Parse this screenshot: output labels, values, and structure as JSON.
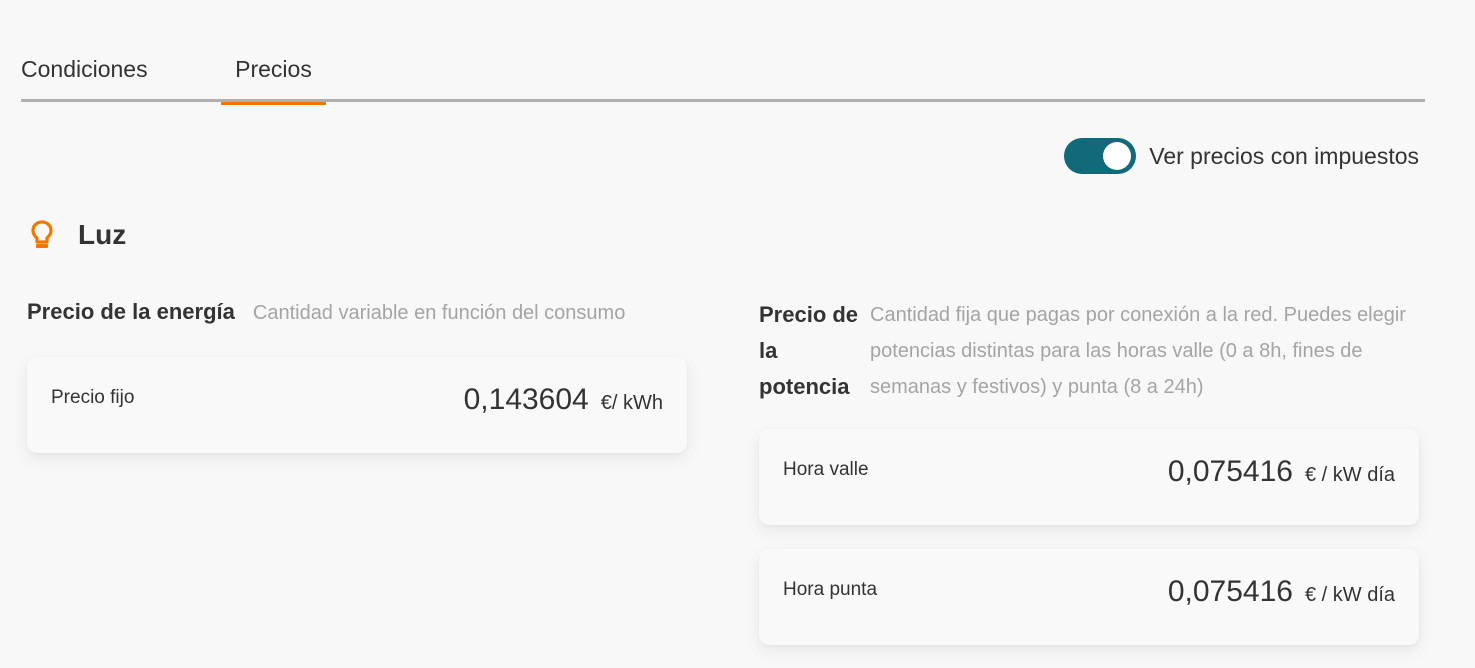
{
  "tabs": [
    {
      "label": "Condiciones",
      "active": false
    },
    {
      "label": "Precios",
      "active": true
    }
  ],
  "toggle": {
    "label": "Ver precios con impuestos",
    "on": true
  },
  "section": {
    "title": "Luz",
    "icon": "lightbulb-icon"
  },
  "energy": {
    "title": "Precio de la energía",
    "description": "Cantidad variable en función del consumo",
    "items": [
      {
        "label": "Precio fijo",
        "value": "0,143604",
        "unit": "€/ kWh"
      }
    ]
  },
  "power": {
    "title": "Precio de la potencia",
    "description": "Cantidad fija que pagas por conexión a la red. Puedes elegir potencias distintas para las horas valle (0 a 8h, fines de semanas y festivos) y punta (8 a 24h)",
    "items": [
      {
        "label": "Hora valle",
        "value": "0,075416",
        "unit": "€ / kW día"
      },
      {
        "label": "Hora punta",
        "value": "0,075416",
        "unit": "€ / kW día"
      }
    ]
  },
  "colors": {
    "accent": "#f07800",
    "toggle": "#106a7a",
    "muted": "#a4a4a4"
  }
}
